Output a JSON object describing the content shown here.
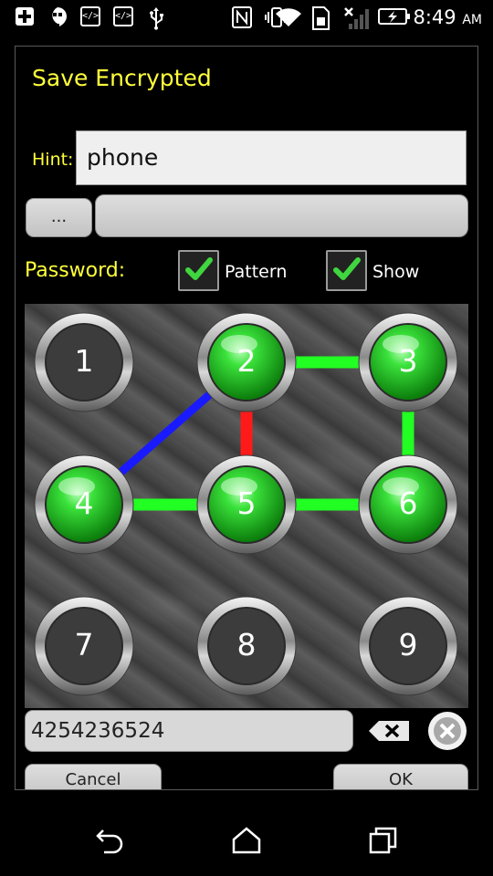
{
  "status_bar": {
    "time": "8:49",
    "ampm": "AM",
    "icons": [
      "plus-icon",
      "hangouts-icon",
      "code-icon",
      "code-icon",
      "usb-icon",
      "nfc-icon",
      "vibrate-icon",
      "wifi-icon",
      "sd-card-icon",
      "no-signal-icon",
      "battery-charging-icon"
    ]
  },
  "dialog": {
    "title": "Save Encrypted",
    "hint_label": "Hint:",
    "hint_value": "phone",
    "dots_button": "...",
    "password_label": "Password:",
    "pattern_label": "Pattern",
    "show_label": "Show",
    "pattern_checked": true,
    "show_checked": true,
    "code_value": "4254236524",
    "cancel_label": "Cancel",
    "ok_label": "OK"
  },
  "pattern": {
    "nodes": [
      "1",
      "2",
      "3",
      "4",
      "5",
      "6",
      "7",
      "8",
      "9"
    ],
    "selected": [
      "2",
      "3",
      "4",
      "5",
      "6"
    ],
    "colors": {
      "segment_green": "#22ff22",
      "segment_red": "#ff1a1a",
      "segment_blue": "#1a1aff",
      "node_green": "#2fd42f"
    }
  },
  "nav_bar": {
    "icons": [
      "back-icon",
      "home-icon",
      "recents-icon"
    ]
  }
}
